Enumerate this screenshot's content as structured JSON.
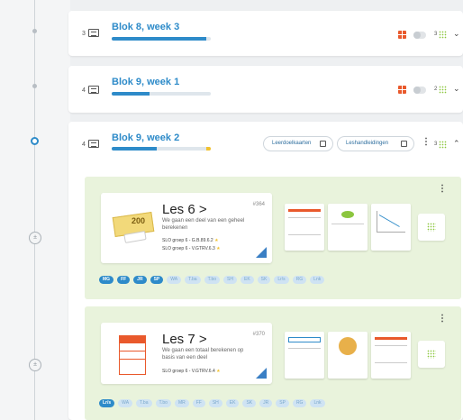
{
  "colors": {
    "accent": "#2e8bc9",
    "panel_green": "#e9f3dc",
    "orange": "#e9592c",
    "yellow": "#f2c12e"
  },
  "bloks": [
    {
      "num": "3",
      "title": "Blok 8, week 3",
      "progress": 0.95,
      "grid_count": "3"
    },
    {
      "num": "4",
      "title": "Blok 9, week 1",
      "progress": 0.38,
      "grid_count": "2"
    },
    {
      "num": "4",
      "title": "Blok 9, week 2",
      "progress": 0.45,
      "grid_count": "3",
      "btn_leerdoelkaarten": "Leerdoelkaarten",
      "btn_leshandleidingen": "Leshandleidingen"
    }
  ],
  "lessons": [
    {
      "title": "Les 6 >",
      "number": "#364",
      "description": "We gaan een deel van een geheel berekenen",
      "slo1": "SLO groep 6 - G.B.89.6.2",
      "slo2": "SLO groep 6 - V.GTRV.6.3",
      "illustration_text": "200",
      "tags": [
        "MG",
        "FF",
        "JR",
        "SP",
        "WA",
        "T.ba",
        "T.bo",
        "SH",
        "EK",
        "SK",
        "Lr/s",
        "RG",
        "Lnk"
      ],
      "active_tags": 4
    },
    {
      "title": "Les 7 >",
      "number": "#370",
      "description": "We gaan een totaal berekenen op basis van een deel",
      "slo1": "SLO groep 6 - V.GTRV.6.4",
      "tags": [
        "Lr/s",
        "WA",
        "T.ba",
        "T.bo",
        "MR",
        "FF",
        "SH",
        "EK",
        "SK",
        "JR",
        "SP",
        "RG",
        "Lnk"
      ],
      "active_tags": 1
    }
  ]
}
